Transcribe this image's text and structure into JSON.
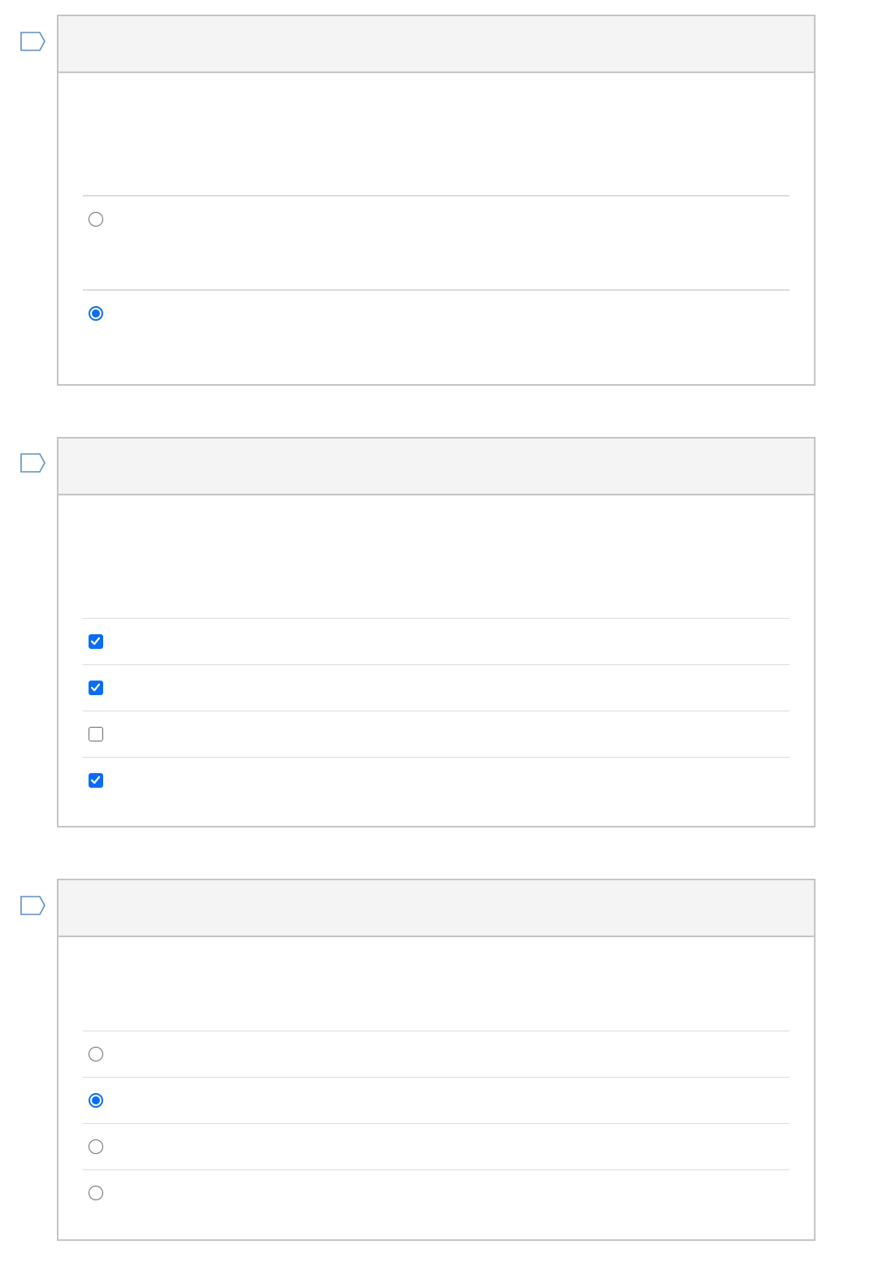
{
  "questions": [
    {
      "type": "single",
      "header": "",
      "prompt": "",
      "options": [
        {
          "label": "",
          "selected": false
        },
        {
          "label": "",
          "selected": true
        }
      ]
    },
    {
      "type": "multiple",
      "header": "",
      "prompt": "",
      "options": [
        {
          "label": "",
          "checked": true
        },
        {
          "label": "",
          "checked": true
        },
        {
          "label": "",
          "checked": false
        },
        {
          "label": "",
          "checked": true
        }
      ]
    },
    {
      "type": "single",
      "header": "",
      "prompt": "",
      "options": [
        {
          "label": "",
          "selected": false
        },
        {
          "label": "",
          "selected": true
        },
        {
          "label": "",
          "selected": false
        },
        {
          "label": "",
          "selected": false
        }
      ]
    }
  ],
  "colors": {
    "accent": "#0b6cf5",
    "header_bg": "#f4f4f4",
    "border": "#c4c4c4",
    "divider": "#dcdcdc",
    "flag_stroke": "#5a8fc4"
  }
}
